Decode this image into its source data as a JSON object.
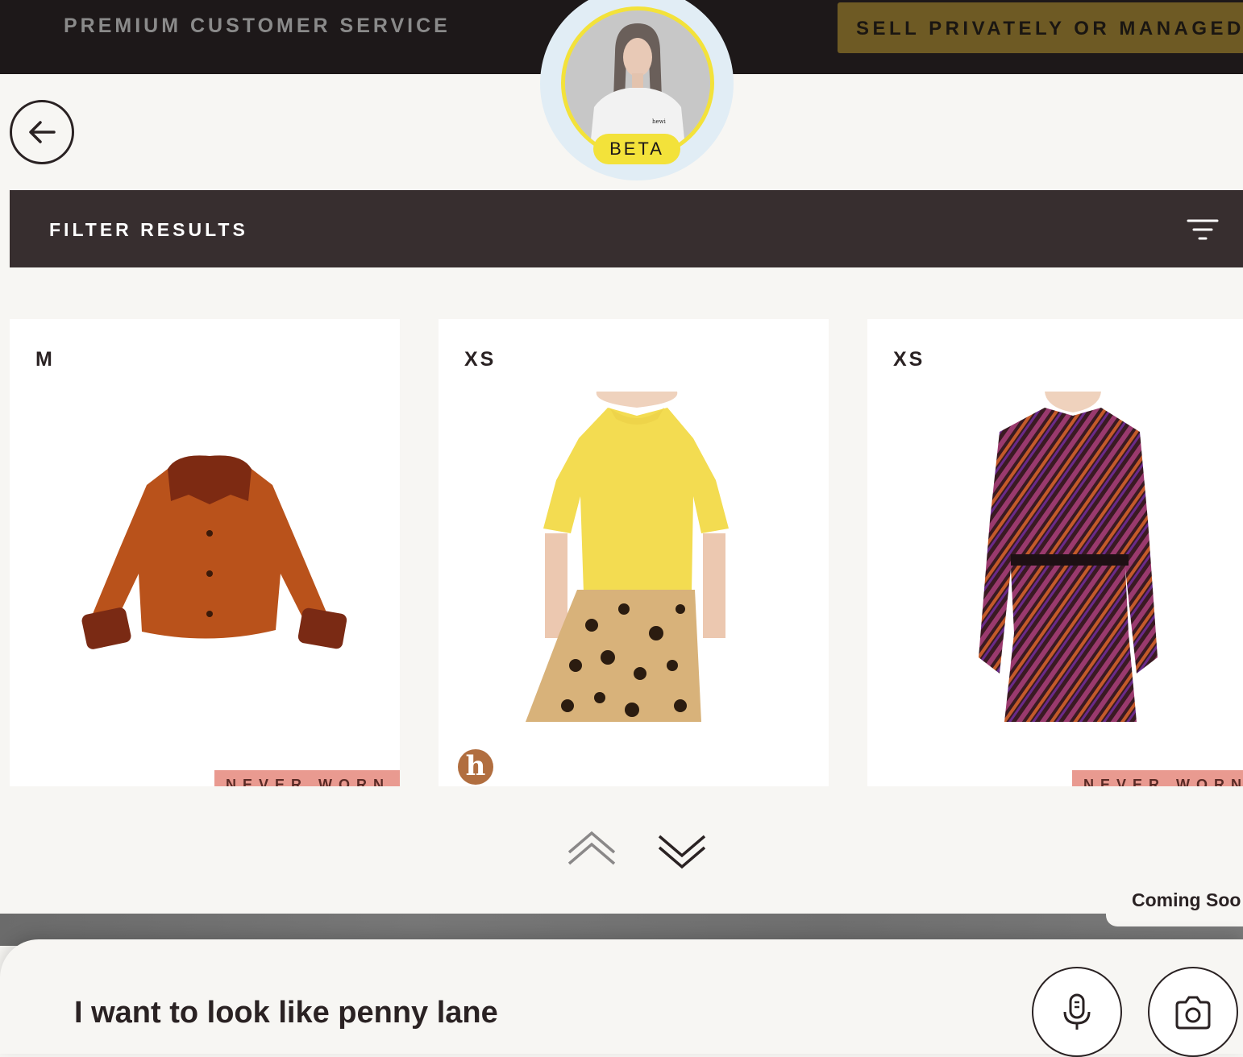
{
  "header": {
    "service_label": "PREMIUM CUSTOMER SERVICE",
    "sell_button_label": "SELL PRIVATELY OR MANAGED",
    "beta_label": "BETA",
    "colors": {
      "bar": "#1d1819",
      "sell_button": "#6e5a24",
      "beta": "#f3e23a"
    }
  },
  "filter": {
    "label": "FILTER RESULTS",
    "icon": "filter-lines-icon"
  },
  "products": [
    {
      "size": "M",
      "item": "orange suede jacket with fur collar",
      "badge": "NEVER WORN"
    },
    {
      "size": "XS",
      "item": "yellow knit top with leopard skirt",
      "badge": "",
      "logo": "h"
    },
    {
      "size": "XS",
      "item": "striped silk shirt dress",
      "badge": "NEVER WORN"
    }
  ],
  "pagination": {
    "up_icon": "chevron-double-up-icon",
    "down_icon": "chevron-double-down-icon"
  },
  "coming_soon": "Coming Soo",
  "query": {
    "text": "I want to look like penny lane"
  },
  "actions": {
    "mic_icon": "microphone-icon",
    "camera_icon": "camera-icon"
  }
}
